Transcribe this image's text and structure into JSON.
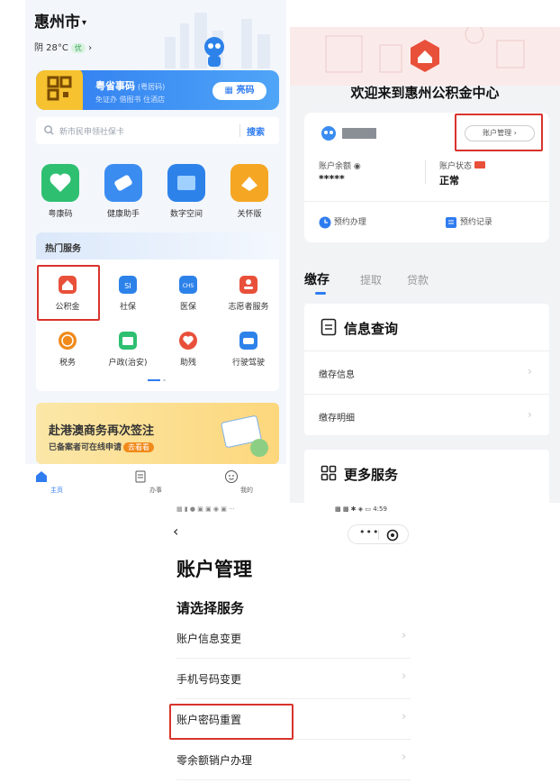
{
  "left": {
    "city": "惠州市",
    "weather": "阴 28°C",
    "air_quality": "优",
    "yueshima": {
      "title": "粤省事码",
      "title_suffix": "(粤居码)",
      "subtitle": "免证办 借图书 住酒店",
      "button": "亮码"
    },
    "search": {
      "placeholder": "新市民申领社保卡",
      "button": "搜索"
    },
    "apps": [
      {
        "label": "粤康码",
        "icon": "health-code-icon",
        "color": "#2fbf71"
      },
      {
        "label": "健康助手",
        "icon": "health-assistant-icon",
        "color": "#3b8cf0"
      },
      {
        "label": "数字空间",
        "icon": "digital-space-icon",
        "color": "#2d82ea"
      },
      {
        "label": "关怀版",
        "icon": "care-version-icon",
        "color": "#f5a623"
      }
    ],
    "hot_title": "热门服务",
    "services": [
      {
        "label": "公积金",
        "icon": "housing-fund-icon",
        "color": "#e8503a"
      },
      {
        "label": "社保",
        "icon": "social-security-icon",
        "color": "#2d82ea"
      },
      {
        "label": "医保",
        "icon": "medical-insurance-icon",
        "color": "#2d82ea"
      },
      {
        "label": "志愿者服务",
        "icon": "volunteer-icon",
        "color": "#e8503a"
      },
      {
        "label": "税务",
        "icon": "tax-icon",
        "color": "#f08a1a"
      },
      {
        "label": "户政(治安)",
        "icon": "household-icon",
        "color": "#2fbf71"
      },
      {
        "label": "助残",
        "icon": "disability-aid-icon",
        "color": "#e8503a"
      },
      {
        "label": "行驶驾驶",
        "icon": "driving-icon",
        "color": "#2d82ea"
      }
    ],
    "banner": {
      "title": "赴港澳商务再次签注",
      "subtitle": "已备案者可在线申请",
      "button": "去看看"
    },
    "tabs": [
      {
        "label": "主页",
        "icon": "home-icon"
      },
      {
        "label": "办事",
        "icon": "tasks-icon"
      },
      {
        "label": "我的",
        "icon": "profile-icon"
      }
    ]
  },
  "right": {
    "title": "欢迎来到惠州公积金中心",
    "manage_button": "账户管理",
    "balance_label": "账户余额",
    "balance_value": "*****",
    "status_label": "账户状态",
    "status_value": "正常",
    "actions": [
      "预约办理",
      "预约记录"
    ],
    "tabs": [
      "缴存",
      "提取",
      "贷款"
    ],
    "query_title": "信息查询",
    "query_items": [
      "缴存信息",
      "缴存明细"
    ],
    "more_title": "更多服务"
  },
  "bottom": {
    "status_time": "4:59",
    "title": "账户管理",
    "subtitle": "请选择服务",
    "items": [
      "账户信息变更",
      "手机号码变更",
      "账户密码重置",
      "零余额销户办理"
    ]
  },
  "colors": {
    "brand_blue": "#2f7cf0",
    "highlight_red": "#d8332d",
    "fund_red": "#e8503a"
  }
}
